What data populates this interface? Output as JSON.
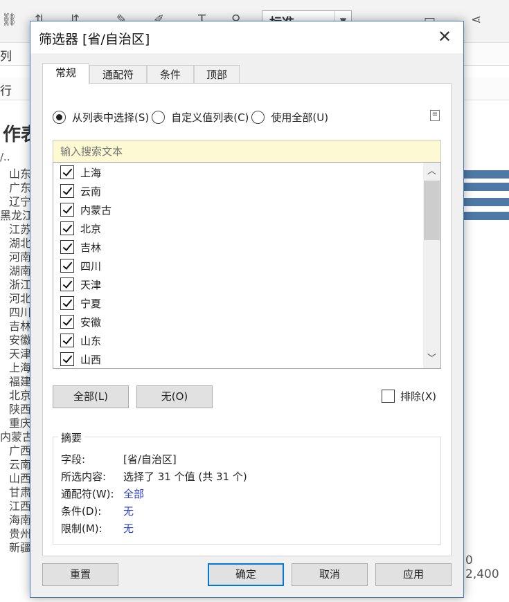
{
  "background": {
    "toolbar_combo": "标准",
    "row1_label": "列",
    "row2_label": "行",
    "sheet_title": "作表",
    "column_header": "/..",
    "provinces": [
      "山东",
      "广东",
      "辽宁",
      "黑龙江",
      "江苏",
      "湖北",
      "河南",
      "湖南",
      "浙江",
      "河北",
      "四川",
      "吉林",
      "安徽",
      "天津",
      "上海",
      "福建",
      "北京",
      "陕西",
      "重庆",
      "内蒙古",
      "广西",
      "云南",
      "山西",
      "甘肃",
      "江西",
      "海南",
      "贵州",
      "新疆"
    ],
    "axis_label": "0 2,400",
    "bar_color": "#4e79a7"
  },
  "dialog": {
    "title": "筛选器 [省/自治区]",
    "tabs": [
      {
        "label": "常规",
        "active": true
      },
      {
        "label": "通配符",
        "active": false
      },
      {
        "label": "条件",
        "active": false
      },
      {
        "label": "顶部",
        "active": false
      }
    ],
    "radios": [
      {
        "label": "从列表中选择(S)",
        "checked": true
      },
      {
        "label": "自定义值列表(C)",
        "checked": false
      },
      {
        "label": "使用全部(U)",
        "checked": false
      }
    ],
    "search_placeholder": "输入搜索文本",
    "items": [
      "上海",
      "云南",
      "内蒙古",
      "北京",
      "吉林",
      "四川",
      "天津",
      "宁夏",
      "安徽",
      "山东",
      "山西"
    ],
    "all_button": "全部(L)",
    "none_button": "无(O)",
    "exclude_label": "排除(X)",
    "summary": {
      "title": "摘要",
      "rows": [
        {
          "key": "字段:",
          "value": "[省/自治区]",
          "link": false
        },
        {
          "key": "所选内容:",
          "value": "选择了 31 个值 (共 31 个)",
          "link": false
        },
        {
          "key": "通配符(W):",
          "value": "全部",
          "link": true
        },
        {
          "key": "条件(D):",
          "value": "无",
          "link": true
        },
        {
          "key": "限制(M):",
          "value": "无",
          "link": true
        }
      ]
    },
    "footer": {
      "reset": "重置",
      "ok": "确定",
      "cancel": "取消",
      "apply": "应用"
    },
    "accent_color": "#0078d7",
    "link_color": "#2a3fcf",
    "search_bg": "#fdf9d2"
  }
}
